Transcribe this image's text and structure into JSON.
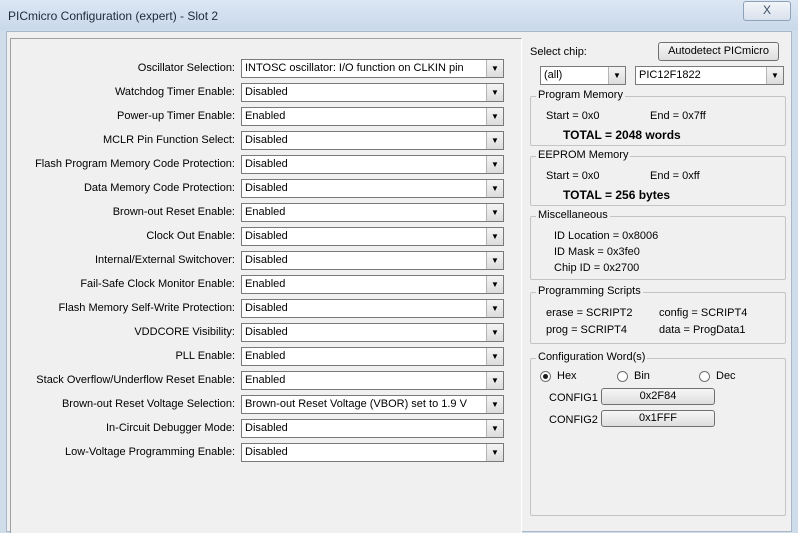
{
  "window": {
    "title": "PICmicro Configuration (expert) - Slot 2",
    "close_glyph": "X"
  },
  "config_rows": [
    {
      "label": "Oscillator Selection:",
      "value": "INTOSC oscillator: I/O function on CLKIN pin"
    },
    {
      "label": "Watchdog Timer Enable:",
      "value": "Disabled"
    },
    {
      "label": "Power-up Timer Enable:",
      "value": "Enabled"
    },
    {
      "label": "MCLR Pin Function Select:",
      "value": "Disabled"
    },
    {
      "label": "Flash Program Memory Code Protection:",
      "value": "Disabled"
    },
    {
      "label": "Data Memory Code Protection:",
      "value": "Disabled"
    },
    {
      "label": "Brown-out Reset Enable:",
      "value": "Enabled"
    },
    {
      "label": "Clock Out Enable:",
      "value": "Disabled"
    },
    {
      "label": "Internal/External Switchover:",
      "value": "Disabled"
    },
    {
      "label": "Fail-Safe Clock Monitor Enable:",
      "value": "Enabled"
    },
    {
      "label": "Flash Memory Self-Write Protection:",
      "value": "Disabled"
    },
    {
      "label": "VDDCORE Visibility:",
      "value": "Disabled"
    },
    {
      "label": "PLL Enable:",
      "value": "Enabled"
    },
    {
      "label": "Stack Overflow/Underflow Reset Enable:",
      "value": "Enabled"
    },
    {
      "label": "Brown-out Reset Voltage Selection:",
      "value": "Brown-out Reset Voltage (VBOR) set to 1.9 V"
    },
    {
      "label": "In-Circuit Debugger Mode:",
      "value": "Disabled"
    },
    {
      "label": "Low-Voltage Programming Enable:",
      "value": "Disabled"
    }
  ],
  "chip": {
    "select_label": "Select chip:",
    "autodetect_label": "Autodetect PICmicro",
    "family_value": "(all)",
    "chip_value": "PIC12F1822"
  },
  "program_memory": {
    "title": "Program Memory",
    "start": "Start = 0x0",
    "end": "End = 0x7ff",
    "total": "TOTAL = 2048 words"
  },
  "eeprom_memory": {
    "title": "EEPROM Memory",
    "start": "Start = 0x0",
    "end": "End = 0xff",
    "total": "TOTAL = 256 bytes"
  },
  "misc": {
    "title": "Miscellaneous",
    "id_location": "ID Location = 0x8006",
    "id_mask": "ID Mask = 0x3fe0",
    "chip_id": "Chip ID = 0x2700"
  },
  "scripts": {
    "title": "Programming Scripts",
    "erase": "erase = SCRIPT2",
    "config": "config = SCRIPT4",
    "prog": "prog = SCRIPT4",
    "data": "data = ProgData1"
  },
  "config_words": {
    "title": "Configuration Word(s)",
    "radix_options": [
      "Hex",
      "Bin",
      "Dec"
    ],
    "selected_radix": "Hex",
    "words": [
      {
        "label": "CONFIG1",
        "value": "0x2F84"
      },
      {
        "label": "CONFIG2",
        "value": "0x1FFF"
      }
    ]
  }
}
